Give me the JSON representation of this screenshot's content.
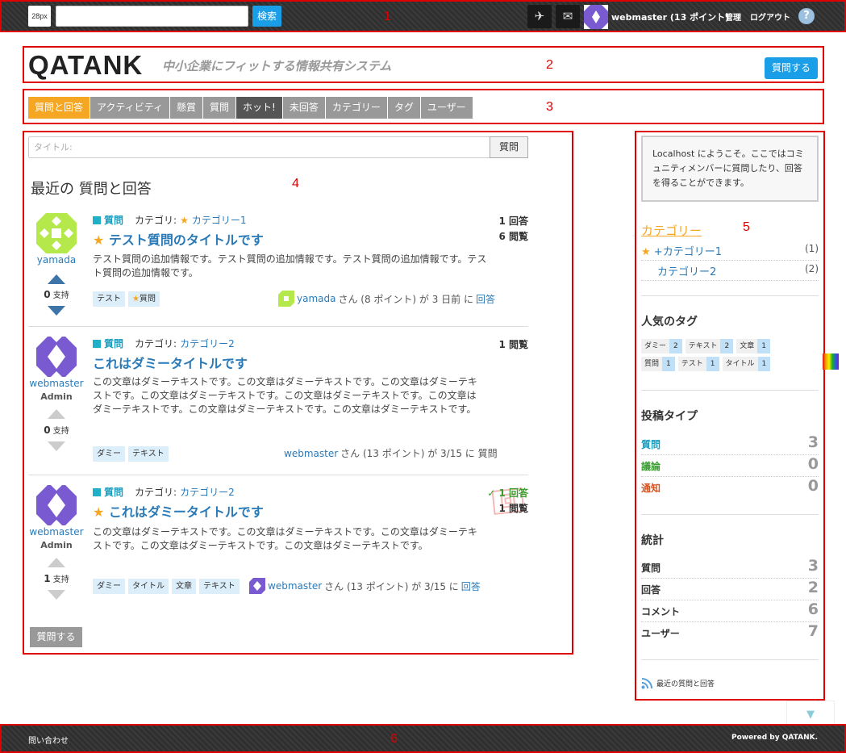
{
  "annotations": {
    "r1": "1",
    "r2": "2",
    "r3": "3",
    "r4": "4",
    "r5": "5",
    "r6": "6"
  },
  "topbar": {
    "font_size_label": "28px",
    "search_value": "",
    "search_button": "検索",
    "send_icon": "paper-plane-icon",
    "mail_icon": "envelope-icon",
    "user": "webmaster (13 ポイント)",
    "admin_link": "管理",
    "logout_link": "ログアウト",
    "help": "?"
  },
  "header": {
    "logo": "QATANK",
    "tagline": "中小企業にフィットする情報共有システム",
    "ask_button": "質問する"
  },
  "nav": {
    "tabs": [
      "質問と回答",
      "アクティビティ",
      "懸賞",
      "質問",
      "ホット!",
      "未回答",
      "カテゴリー",
      "タグ",
      "ユーザー"
    ],
    "active": "質問と回答"
  },
  "main": {
    "search_placeholder": "タイトル:",
    "search_button": "質問",
    "title": "最近の 質問と回答",
    "ask_button": "質問する",
    "questions": [
      {
        "user": "yamada",
        "votes": "0",
        "vote_label": "支持",
        "type": "質問",
        "category_label": "カテゴリ:",
        "category": "カテゴリー1",
        "title": "テスト質問のタイトルです",
        "body": "テスト質問の追加情報です。テスト質問の追加情報です。テスト質問の追加情報です。テスト質問の追加情報です。",
        "answers": "1 回答",
        "views": "6 閲覧",
        "tags": [
          "テスト",
          "質問"
        ],
        "by_user": "yamada",
        "by_rest": "さん (8 ポイント) が 3 日前 に",
        "by_action": "回答"
      },
      {
        "user": "webmaster",
        "role": "Admin",
        "votes": "0",
        "vote_label": "支持",
        "type": "質問",
        "category_label": "カテゴリ:",
        "category": "カテゴリー2",
        "title": "これはダミータイトルです",
        "body": "この文章はダミーテキストです。この文章はダミーテキストです。この文章はダミーテキストです。この文章はダミーテキストです。この文章はダミーテキストです。この文章はダミーテキストです。この文章はダミーテキストです。この文章はダミーテキストです。",
        "views": "1 閲覧",
        "tags": [
          "ダミー",
          "テキスト"
        ],
        "by_user": "webmaster",
        "by_rest": "さん (13 ポイント) が 3/15 に 質問"
      },
      {
        "user": "webmaster",
        "role": "Admin",
        "votes": "1",
        "vote_label": "支持",
        "type": "質問",
        "category_label": "カテゴリ:",
        "category": "カテゴリー2",
        "title": "これはダミータイトルです",
        "body": "この文章はダミーテキストです。この文章はダミーテキストです。この文章はダミーテキストです。この文章はダミーテキストです。この文章はダミーテキストです。",
        "answers": "✓ 1 回答",
        "views": "1 閲覧",
        "stamp": "回",
        "tags": [
          "ダミー",
          "タイトル",
          "文章",
          "テキスト"
        ],
        "by_user": "webmaster",
        "by_rest": "さん (13 ポイント) が 3/15 に",
        "by_action": "回答"
      }
    ]
  },
  "sidebar": {
    "welcome": "Localhost にようこそ。ここではコミュニティメンバーに質問したり、回答を得ることができます。",
    "categories_title": "カテゴリー",
    "categories": [
      {
        "name": "+カテゴリー1",
        "count": "(1)"
      },
      {
        "name": "カテゴリー2",
        "count": "(2)"
      }
    ],
    "tags_title": "人気のタグ",
    "tags": [
      {
        "t": "ダミー",
        "n": "2"
      },
      {
        "t": "テキスト",
        "n": "2"
      },
      {
        "t": "文章",
        "n": "1"
      },
      {
        "t": "質問",
        "n": "1"
      },
      {
        "t": "テスト",
        "n": "1"
      },
      {
        "t": "タイトル",
        "n": "1"
      }
    ],
    "post_types_title": "投稿タイプ",
    "post_types": [
      {
        "name": "質問",
        "value": "3",
        "color": "#1a9ec0"
      },
      {
        "name": "議論",
        "value": "0",
        "color": "#3a9e30"
      },
      {
        "name": "通知",
        "value": "0",
        "color": "#d9531e"
      }
    ],
    "stats_title": "統計",
    "stats": [
      {
        "name": "質問",
        "value": "3"
      },
      {
        "name": "回答",
        "value": "2"
      },
      {
        "name": "コメント",
        "value": "6"
      },
      {
        "name": "ユーザー",
        "value": "7"
      }
    ],
    "rss_label": "最近の質問と回答"
  },
  "scroll_top": "▼",
  "footer": {
    "contact": "問い合わせ",
    "powered": "Powered by QATANK."
  }
}
